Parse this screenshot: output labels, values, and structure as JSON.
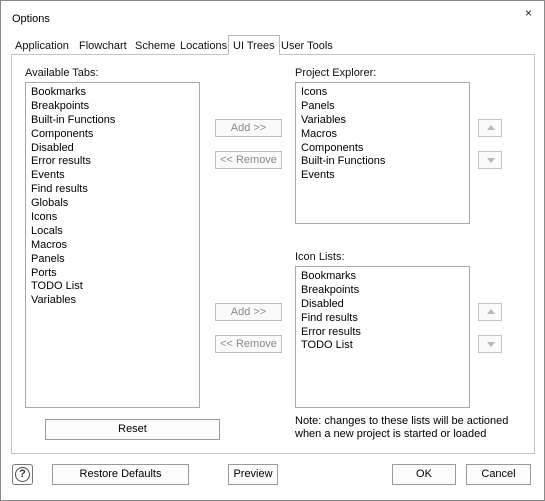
{
  "window": {
    "title": "Options",
    "close_glyph": "×"
  },
  "tabs": [
    {
      "label": "Application"
    },
    {
      "label": "Flowchart"
    },
    {
      "label": "Scheme"
    },
    {
      "label": "Locations"
    },
    {
      "label": "UI Trees",
      "active": true
    },
    {
      "label": "User Tools"
    }
  ],
  "available_tabs": {
    "label": "Available Tabs:",
    "items": [
      "Bookmarks",
      "Breakpoints",
      "Built-in Functions",
      "Components",
      "Disabled",
      "Error results",
      "Events",
      "Find results",
      "Globals",
      "Icons",
      "Locals",
      "Macros",
      "Panels",
      "Ports",
      "TODO List",
      "Variables"
    ]
  },
  "project_explorer": {
    "label": "Project Explorer:",
    "items": [
      "Icons",
      "Panels",
      "Variables",
      "Macros",
      "Components",
      "Built-in Functions",
      "Events"
    ],
    "add_label": "Add >>",
    "remove_label": "<< Remove"
  },
  "icon_lists": {
    "label": "Icon Lists:",
    "items": [
      "Bookmarks",
      "Breakpoints",
      "Disabled",
      "Find results",
      "Error results",
      "TODO List"
    ],
    "add_label": "Add >>",
    "remove_label": "<< Remove"
  },
  "reset_label": "Reset",
  "note": "Note: changes to these lists will be actioned when a new project is started or loaded",
  "footer": {
    "restore_defaults": "Restore Defaults",
    "preview": "Preview",
    "ok": "OK",
    "cancel": "Cancel"
  },
  "icons": {
    "help": "help-icon",
    "up": "arrow-up-icon",
    "down": "arrow-down-icon"
  }
}
